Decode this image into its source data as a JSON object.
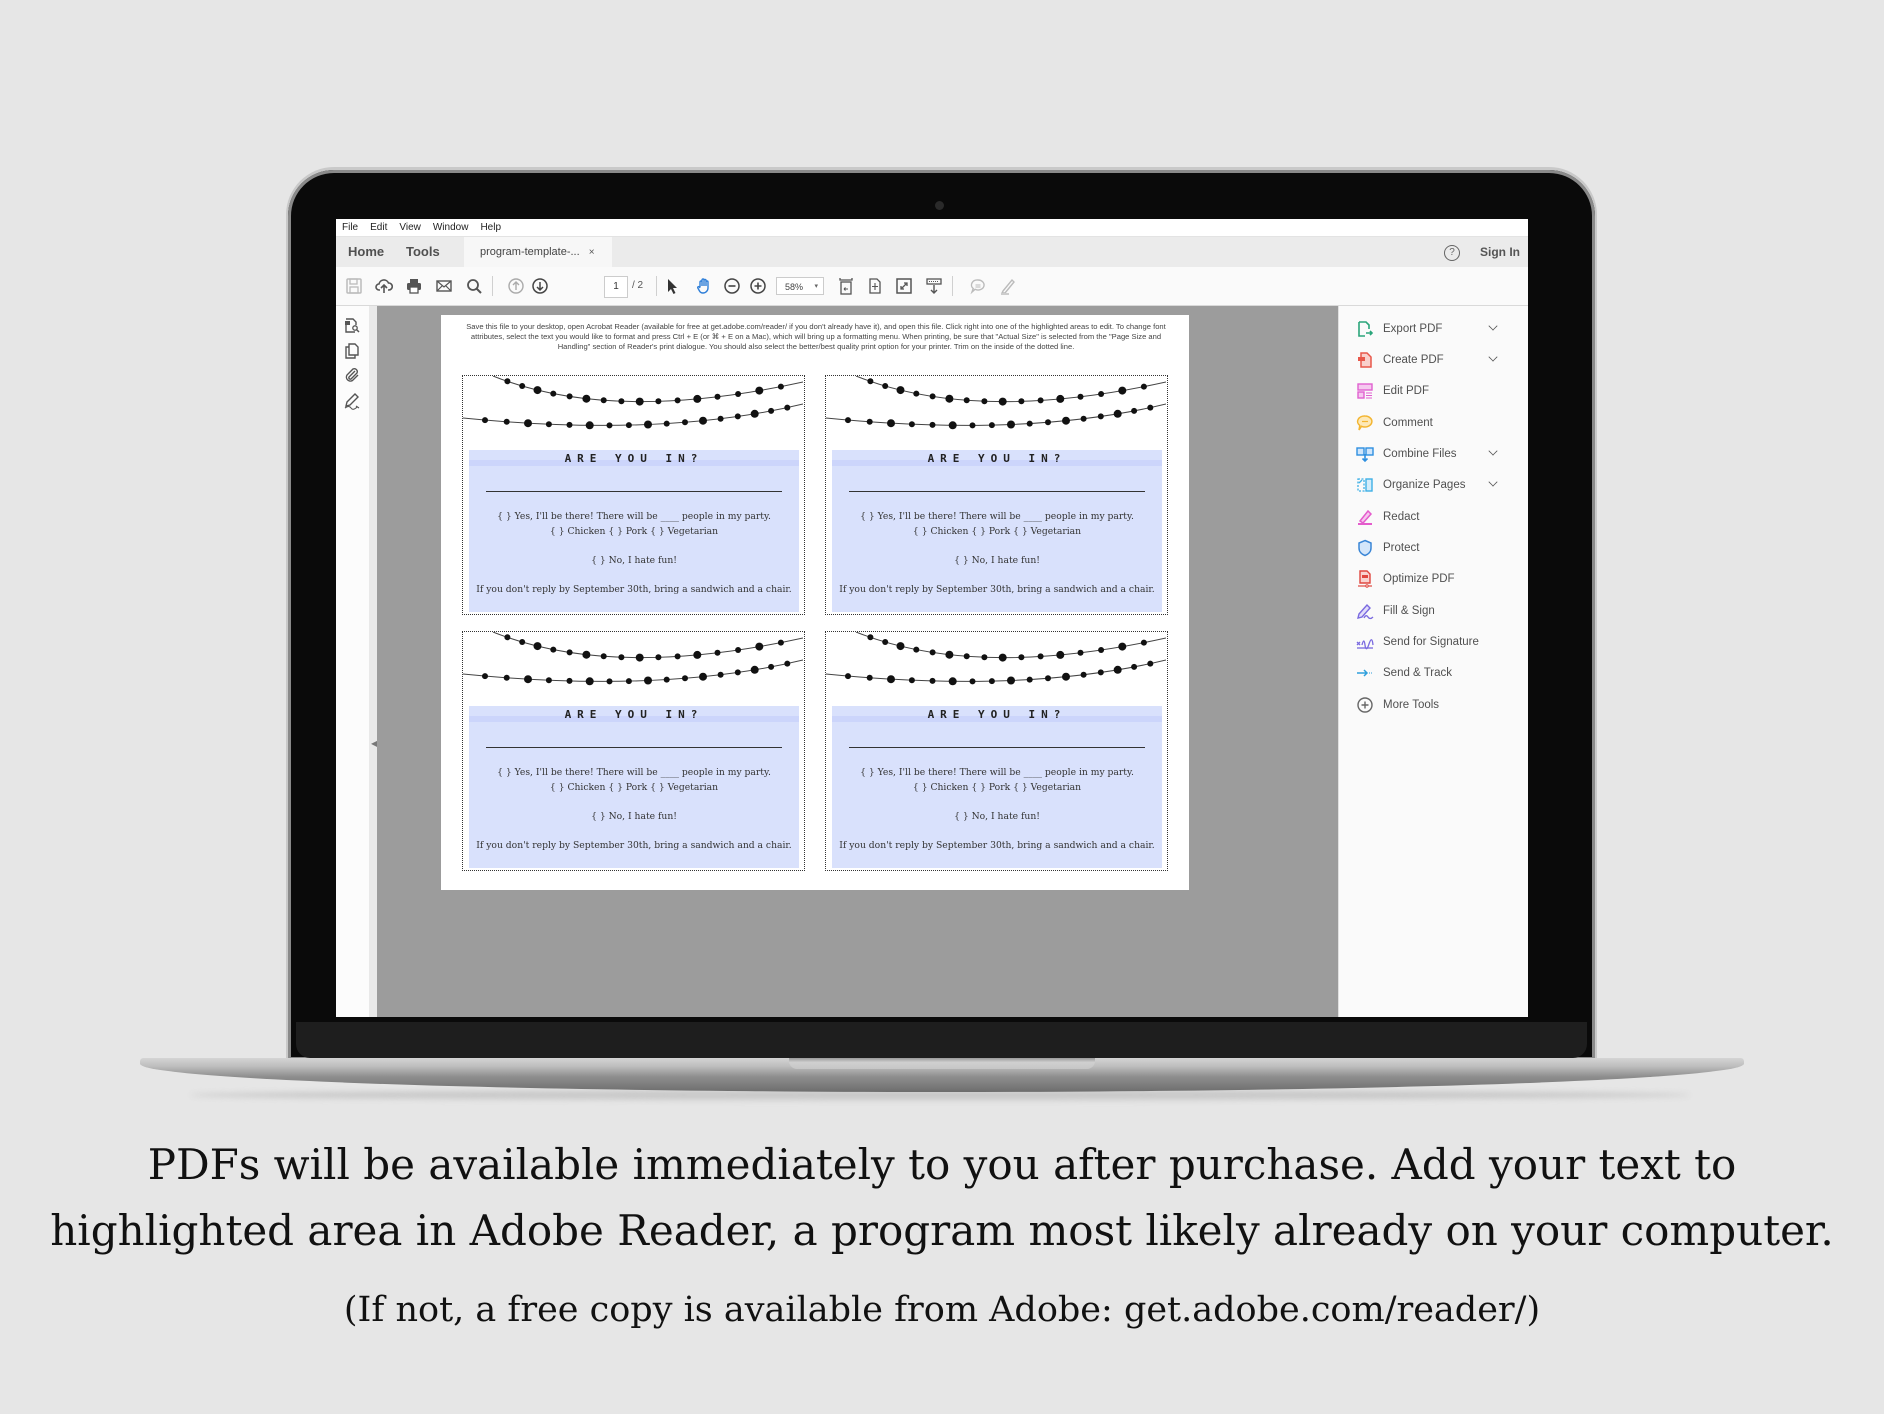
{
  "app": {
    "menu": [
      "File",
      "Edit",
      "View",
      "Window",
      "Help"
    ],
    "tabs": {
      "home": "Home",
      "tools": "Tools",
      "document": "program-template-...",
      "close": "×"
    },
    "help_icon": "?",
    "sign_in": "Sign In"
  },
  "toolbar": {
    "icons": [
      "save-icon",
      "upload-cloud-icon",
      "print-icon",
      "email-icon",
      "search-icon",
      "page-up-icon",
      "page-down-icon",
      "select-pointer-icon",
      "hand-icon",
      "zoom-out-icon",
      "zoom-in-icon",
      "fit-page-icon",
      "fit-width-icon",
      "full-screen-icon",
      "scroll-mode-icon",
      "comment-icon",
      "highlight-pen-icon"
    ],
    "page_current": "1",
    "page_total": "/ 2",
    "zoom": "58%",
    "zoom_caret": "▾"
  },
  "left_nav": {
    "icons": [
      "page-thumbnails-icon",
      "copy-pages-icon",
      "attachments-icon",
      "signature-pen-icon"
    ],
    "collapse": "◀"
  },
  "document": {
    "instructions": "Save this file to your desktop, open Acrobat Reader (available for free at get.adobe.com/reader/ if you don't already have it), and open this file.  Click right into one of the highlighted areas to edit. To change font attributes, select the text you would like to format and press Ctrl + E (or ⌘ + E on a Mac), which will bring up a formatting menu.  When printing, be sure that \"Actual Size\" is selected from the \"Page Size and Handling\" section of Reader's print dialogue. You should also select the better/best quality print option for your printer. Trim on the inside of the dotted line.",
    "cards": [
      {
        "title": "ARE YOU IN?",
        "yes": "{  }  Yes, I'll be there!  There will be ____ people in my party.",
        "meals": "{  } Chicken  {  }  Pork  {  } Vegetarian",
        "no": "{  }  No, I hate fun!",
        "footer": "If you don't reply by September 30th, bring a sandwich and a chair."
      },
      {
        "title": "ARE YOU IN?",
        "yes": "{  }  Yes, I'll be there!  There will be ____ people in my party.",
        "meals": "{  } Chicken  {  }  Pork  {  } Vegetarian",
        "no": "{  }  No, I hate fun!",
        "footer": "If you don't reply by September 30th, bring a sandwich and a chair."
      },
      {
        "title": "ARE YOU IN?",
        "yes": "{  }  Yes, I'll be there!  There will be ____ people in my party.",
        "meals": "{  } Chicken  {  }  Pork  {  } Vegetarian",
        "no": "{  }  No, I hate fun!",
        "footer": "If you don't reply by September 30th, bring a sandwich and a chair."
      },
      {
        "title": "ARE YOU IN?",
        "yes": "{  }  Yes, I'll be there!  There will be ____ people in my party.",
        "meals": "{  } Chicken  {  }  Pork  {  } Vegetarian",
        "no": "{  }  No, I hate fun!",
        "footer": "If you don't reply by September 30th, bring a sandwich and a chair."
      }
    ],
    "rsvp_fill_color": "#d9e1fc"
  },
  "tools_panel": {
    "items": [
      {
        "label": "Export PDF",
        "icon": "export-pdf-icon",
        "color": "#2aa57a",
        "has_chevron": true
      },
      {
        "label": "Create PDF",
        "icon": "create-pdf-icon",
        "color": "#e8574a",
        "has_chevron": true
      },
      {
        "label": "Edit PDF",
        "icon": "edit-pdf-icon",
        "color": "#e060d0",
        "has_chevron": false
      },
      {
        "label": "Comment",
        "icon": "comment-icon",
        "color": "#f3b531",
        "has_chevron": false
      },
      {
        "label": "Combine Files",
        "icon": "combine-files-icon",
        "color": "#2d8fe0",
        "has_chevron": true
      },
      {
        "label": "Organize Pages",
        "icon": "organize-pages-icon",
        "color": "#3fb0e6",
        "has_chevron": true
      },
      {
        "label": "Redact",
        "icon": "redact-icon",
        "color": "#e45ccc",
        "has_chevron": false
      },
      {
        "label": "Protect",
        "icon": "protect-shield-icon",
        "color": "#3a86d6",
        "has_chevron": false
      },
      {
        "label": "Optimize PDF",
        "icon": "optimize-pdf-icon",
        "color": "#e0473f",
        "has_chevron": false
      },
      {
        "label": "Fill & Sign",
        "icon": "fill-sign-icon",
        "color": "#7a6ae0",
        "has_chevron": false
      },
      {
        "label": "Send for Signature",
        "icon": "send-signature-icon",
        "color": "#7a6ae0",
        "has_chevron": false
      },
      {
        "label": "Send & Track",
        "icon": "send-track-icon",
        "color": "#2e9fdc",
        "has_chevron": false
      },
      {
        "label": "More Tools",
        "icon": "plus-circle-icon",
        "color": "#666666",
        "has_chevron": false
      }
    ]
  },
  "caption": {
    "line1": "PDFs will be available immediately to you after purchase.  Add your text to",
    "line2": "highlighted area in Adobe Reader, a program most likely already on your computer.",
    "line3": "(If not, a free copy is available from Adobe: get.adobe.com/reader/)"
  }
}
